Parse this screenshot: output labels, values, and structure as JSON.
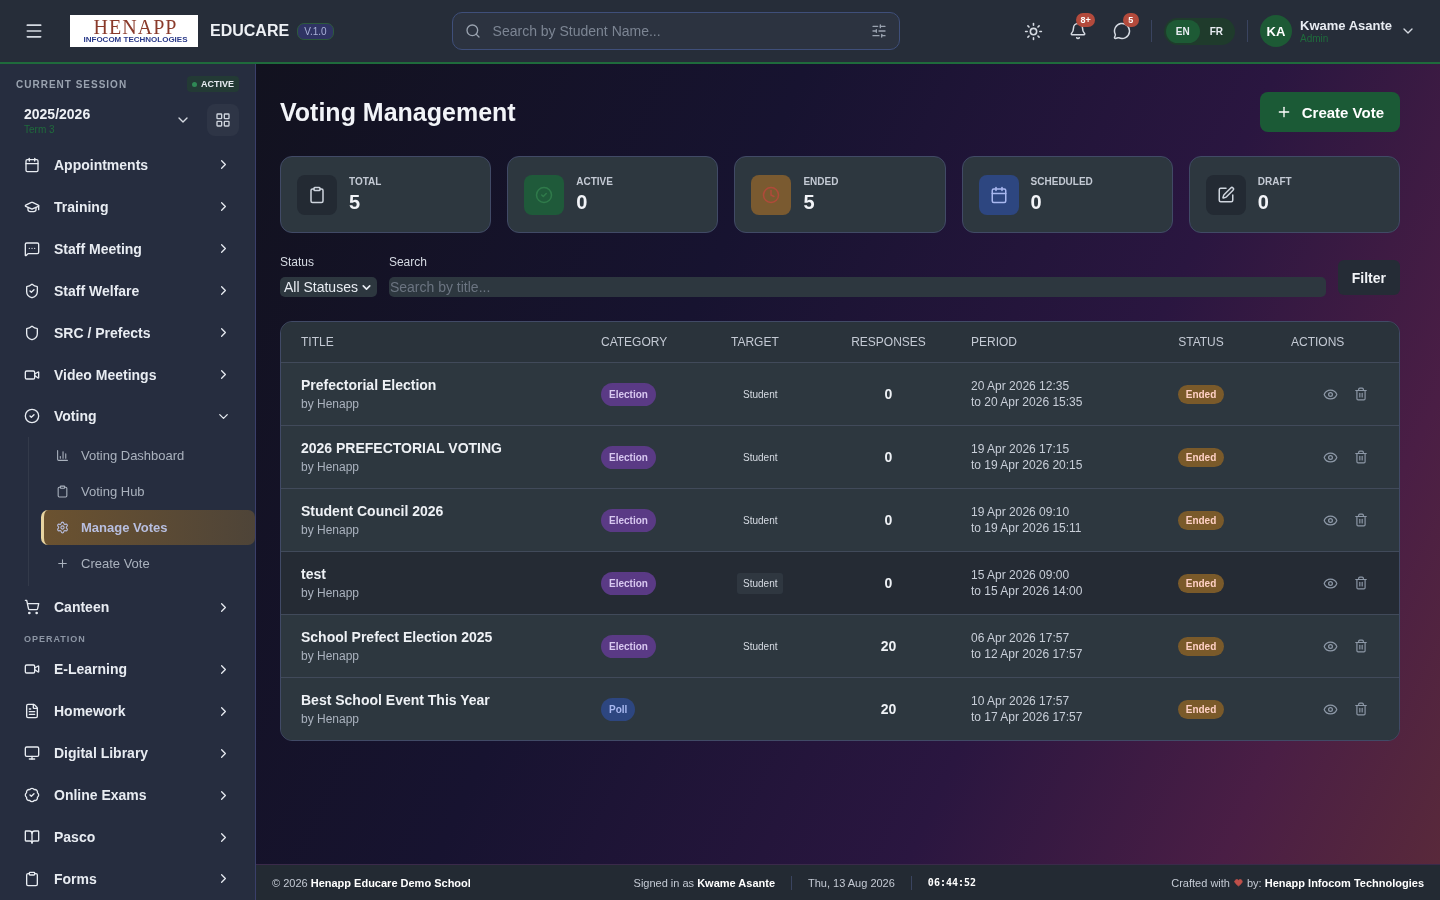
{
  "header": {
    "logo": {
      "name": "HENAPP",
      "tagline": "INFOCOM TECHNOLOGIES"
    },
    "app_name": "EDUCARE",
    "version": "V.1.0",
    "search": {
      "placeholder": "Search by Student Name..."
    },
    "notifications_badge": "8+",
    "messages_badge": "5",
    "languages": [
      {
        "label": "EN",
        "selected": true
      },
      {
        "label": "FR",
        "selected": false
      }
    ],
    "user": {
      "initials": "KA",
      "name": "Kwame Asante",
      "role": "Admin"
    }
  },
  "sidebar": {
    "session": {
      "label": "CURRENT SESSION",
      "status": "ACTIVE",
      "year": "2025/2026",
      "term": "Term 3"
    },
    "sections": [
      {
        "items": [
          {
            "label": "Appointments",
            "expanded": false
          },
          {
            "label": "Training",
            "expanded": false
          },
          {
            "label": "Staff Meeting",
            "expanded": false
          },
          {
            "label": "Staff Welfare",
            "expanded": false
          },
          {
            "label": "SRC / Prefects",
            "expanded": false
          },
          {
            "label": "Video Meetings",
            "expanded": false
          },
          {
            "label": "Voting",
            "expanded": true,
            "children": [
              {
                "label": "Voting Dashboard",
                "selected": false
              },
              {
                "label": "Voting Hub",
                "selected": false
              },
              {
                "label": "Manage Votes",
                "selected": true
              },
              {
                "label": "Create Vote",
                "selected": false
              }
            ]
          },
          {
            "label": "Canteen",
            "expanded": false
          }
        ]
      },
      {
        "title": "OPERATION",
        "items": [
          {
            "label": "E-Learning",
            "expanded": false
          },
          {
            "label": "Homework",
            "expanded": false
          },
          {
            "label": "Digital Library",
            "expanded": false
          },
          {
            "label": "Online Exams",
            "expanded": false
          },
          {
            "label": "Pasco",
            "expanded": false
          },
          {
            "label": "Forms",
            "expanded": false
          }
        ]
      }
    ]
  },
  "page": {
    "title": "Voting Management",
    "create_button": "Create Vote",
    "stats": [
      {
        "kind": "total",
        "label": "TOTAL",
        "value": "5"
      },
      {
        "kind": "active",
        "label": "ACTIVE",
        "value": "0"
      },
      {
        "kind": "ended",
        "label": "ENDED",
        "value": "5"
      },
      {
        "kind": "scheduled",
        "label": "SCHEDULED",
        "value": "0"
      },
      {
        "kind": "draft",
        "label": "DRAFT",
        "value": "0"
      }
    ],
    "filters": {
      "status_label": "Status",
      "status_value": "All Statuses",
      "search_label": "Search",
      "search_placeholder": "Search by title...",
      "button": "Filter"
    },
    "table": {
      "columns": [
        "TITLE",
        "CATEGORY",
        "TARGET",
        "RESPONSES",
        "PERIOD",
        "STATUS",
        "ACTIONS"
      ],
      "rows": [
        {
          "title": "Prefectorial Election",
          "author": "by Henapp",
          "category": "Election",
          "kind": "election",
          "target": "Student",
          "responses": "0",
          "period_start": "20 Apr 2026 12:35",
          "period_end": "to 20 Apr 2026 15:35",
          "status": "Ended",
          "highlighted": false
        },
        {
          "title": "2026 PREFECTORIAL VOTING",
          "author": "by Henapp",
          "category": "Election",
          "kind": "election",
          "target": "Student",
          "responses": "0",
          "period_start": "19 Apr 2026 17:15",
          "period_end": "to 19 Apr 2026 20:15",
          "status": "Ended",
          "highlighted": false
        },
        {
          "title": "Student Council 2026",
          "author": "by Henapp",
          "category": "Election",
          "kind": "election",
          "target": "Student",
          "responses": "0",
          "period_start": "19 Apr 2026 09:10",
          "period_end": "to 19 Apr 2026 15:11",
          "status": "Ended",
          "highlighted": false
        },
        {
          "title": "test",
          "author": "by Henapp",
          "category": "Election",
          "kind": "election",
          "target": "Student",
          "responses": "0",
          "period_start": "15 Apr 2026 09:00",
          "period_end": "to 15 Apr 2026 14:00",
          "status": "Ended",
          "highlighted": true
        },
        {
          "title": "School Prefect Election 2025",
          "author": "by Henapp",
          "category": "Election",
          "kind": "election",
          "target": "Student",
          "responses": "20",
          "period_start": "06 Apr 2026 17:57",
          "period_end": "to 12 Apr 2026 17:57",
          "status": "Ended",
          "highlighted": false
        },
        {
          "title": "Best School Event This Year",
          "author": "by Henapp",
          "category": "Poll",
          "kind": "poll",
          "responses": "20",
          "period_start": "10 Apr 2026 17:57",
          "period_end": "to 17 Apr 2026 17:57",
          "status": "Ended",
          "highlighted": false
        }
      ]
    }
  },
  "footer": {
    "copyright": "© 2026 **Henapp Educare Demo School**",
    "signed_in": "Signed in as **Kwame Asante**",
    "date": "Thu, 13 Aug 2026",
    "time": "06:44:52",
    "crafted_prefix": "Crafted with",
    "crafted_suffix": "by: **Henapp Infocom Technologies**"
  }
}
